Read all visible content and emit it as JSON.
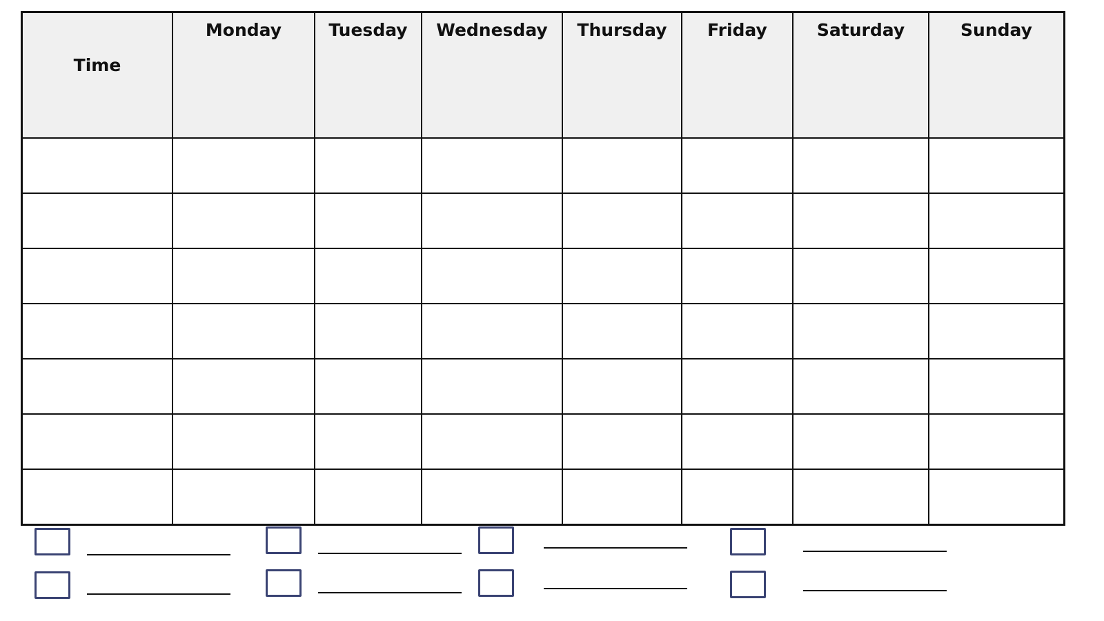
{
  "schedule": {
    "headers": [
      "Time",
      "Monday",
      "Tuesday",
      "Wednesday",
      "Thursday",
      "Friday",
      "Saturday",
      "Sunday"
    ],
    "rows": [
      [
        "",
        "",
        "",
        "",
        "",
        "",
        "",
        ""
      ],
      [
        "",
        "",
        "",
        "",
        "",
        "",
        "",
        ""
      ],
      [
        "",
        "",
        "",
        "",
        "",
        "",
        "",
        ""
      ],
      [
        "",
        "",
        "",
        "",
        "",
        "",
        "",
        ""
      ],
      [
        "",
        "",
        "",
        "",
        "",
        "",
        "",
        ""
      ],
      [
        "",
        "",
        "",
        "",
        "",
        "",
        "",
        ""
      ],
      [
        "",
        "",
        "",
        "",
        "",
        "",
        "",
        ""
      ]
    ]
  },
  "legend": {
    "items": [
      {
        "label": ""
      },
      {
        "label": ""
      },
      {
        "label": ""
      },
      {
        "label": ""
      },
      {
        "label": ""
      },
      {
        "label": ""
      },
      {
        "label": ""
      },
      {
        "label": ""
      }
    ],
    "box_color": "#3a4373"
  }
}
